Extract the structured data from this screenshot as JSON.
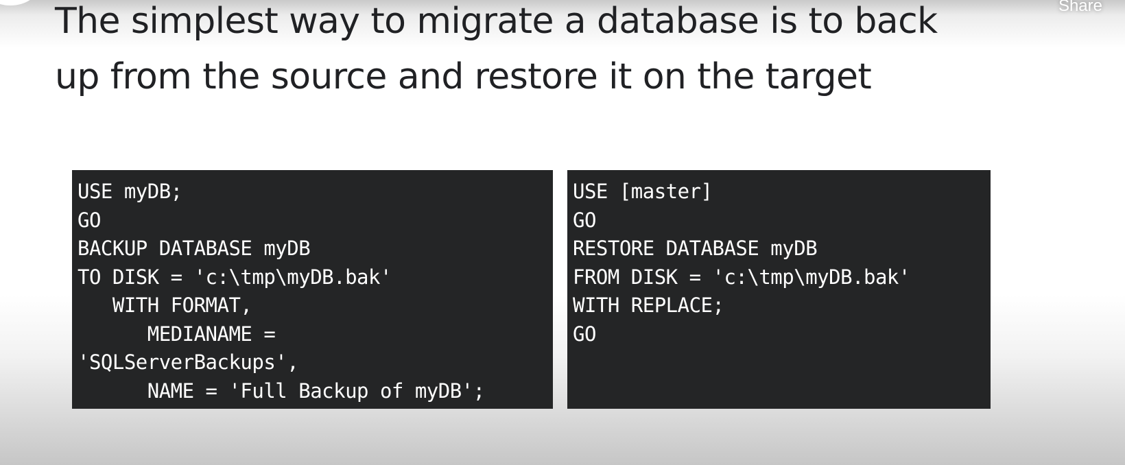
{
  "header": {
    "share_label": "Share"
  },
  "slide": {
    "title": "The simplest way to migrate a database is to back\nup from the source and restore it on the target"
  },
  "code": {
    "backup": "USE myDB;\nGO\nBACKUP DATABASE myDB\nTO DISK = 'c:\\tmp\\myDB.bak'\n   WITH FORMAT,\n      MEDIANAME =\n'SQLServerBackups',\n      NAME = 'Full Backup of myDB';",
    "restore": "USE [master]\nGO\nRESTORE DATABASE myDB\nFROM DISK = 'c:\\tmp\\myDB.bak'\nWITH REPLACE;\nGO"
  },
  "colors": {
    "code_background": "#242526",
    "code_text": "#ffffff",
    "title_text": "#202124"
  }
}
